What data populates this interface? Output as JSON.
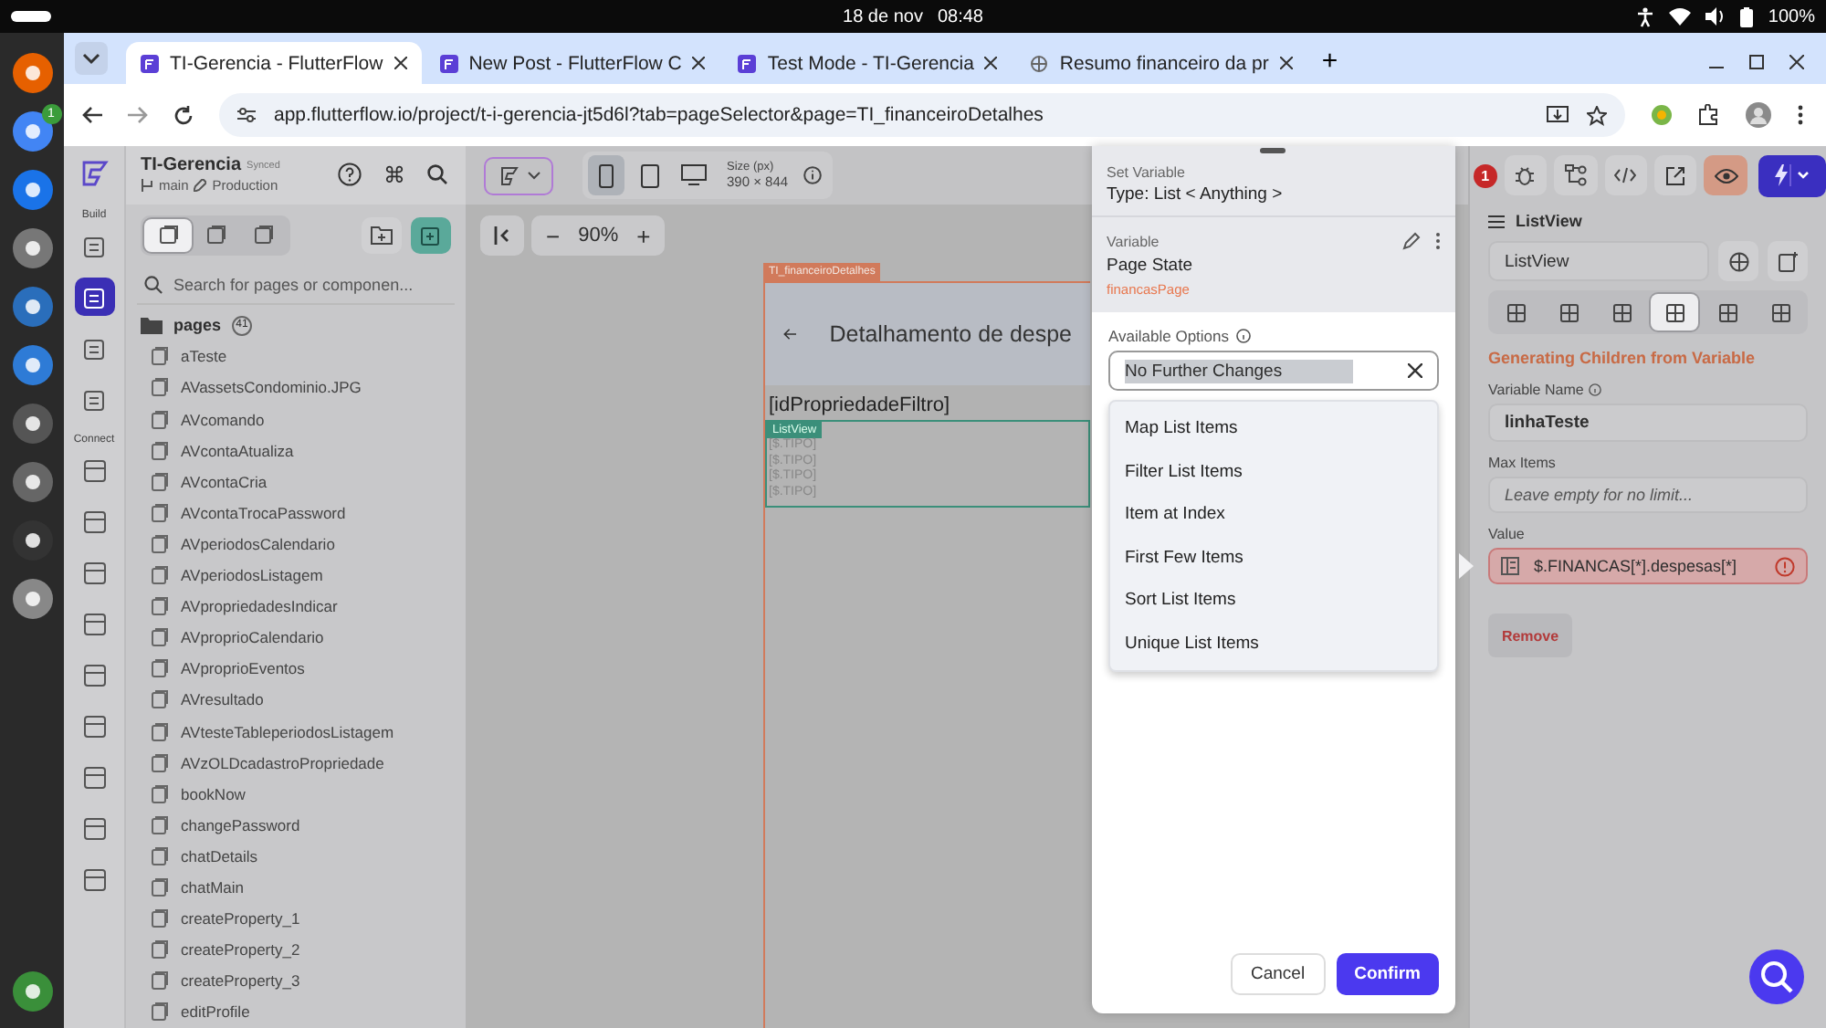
{
  "os_bar": {
    "date": "18 de nov",
    "time": "08:48",
    "battery": "100%"
  },
  "dock": {
    "badge": "1"
  },
  "browser": {
    "tabs": [
      {
        "title": "TI-Gerencia - FlutterFlow",
        "selected": true
      },
      {
        "title": "New Post - FlutterFlow C",
        "selected": false
      },
      {
        "title": "Test Mode - TI-Gerencia",
        "selected": false
      },
      {
        "title": "Resumo financeiro da pr",
        "selected": false
      }
    ],
    "new_tab": "+",
    "url": "app.flutterflow.io/project/t-i-gerencia-jt5d6l?tab=pageSelector&page=TI_financeiroDetalhes"
  },
  "project": {
    "name": "TI-Gerencia",
    "sync": "Synced",
    "branch": "main",
    "env": "Production",
    "shortcut": "⌘"
  },
  "rail": {
    "build_label": "Build",
    "build_items": [
      {
        "selected": false
      },
      {
        "selected": true
      },
      {
        "selected": false
      },
      {
        "selected": false
      }
    ],
    "connect_label": "Connect",
    "connect_items": [
      {
        "selected": false
      },
      {
        "selected": false
      },
      {
        "selected": false
      },
      {
        "selected": false
      },
      {
        "selected": false
      },
      {
        "selected": false
      },
      {
        "selected": false
      },
      {
        "selected": false
      },
      {
        "selected": false
      }
    ]
  },
  "pages_panel": {
    "view_toggles": [
      {
        "selected": true
      },
      {
        "selected": false
      },
      {
        "selected": false
      }
    ],
    "search_placeholder": "Search for pages or componen...",
    "folder": "pages",
    "count": "41",
    "pages": [
      "aTeste",
      "AVassetsCondominio.JPG",
      "AVcomando",
      "AVcontaAtualiza",
      "AVcontaCria",
      "AVcontaTrocaPassword",
      "AVperiodosCalendario",
      "AVperiodosListagem",
      "AVpropriedadesIndicar",
      "AVproprioCalendario",
      "AVproprioEventos",
      "AVresultado",
      "AVtesteTableperiodosListagem",
      "AVzOLDcadastroPropriedade",
      "bookNow",
      "changePassword",
      "chatDetails",
      "chatMain",
      "createProperty_1",
      "createProperty_2",
      "createProperty_3",
      "editProfile"
    ]
  },
  "canvas": {
    "devices": [
      {
        "kind": "phone",
        "selected": true
      },
      {
        "kind": "tablet",
        "selected": false
      },
      {
        "kind": "desktop",
        "selected": false
      }
    ],
    "size_label": "Size (px)",
    "size": "390 × 844",
    "zoom_minus": "−",
    "zoom": "90%",
    "zoom_plus": "+",
    "page_tag": "TI_financeiroDetalhes",
    "page_title": "Detalhamento de despe",
    "filter_text": "[idPropriedadeFiltro]",
    "listview_tag": "ListView",
    "list_rows": [
      "[$.TIPO]",
      "[$.TIPO]",
      "[$.TIPO]",
      "[$.TIPO]"
    ]
  },
  "modal": {
    "title": "Set Variable",
    "type": "Type: List < Anything >",
    "variable_label": "Variable",
    "variable_source": "Page State",
    "variable_name": "financasPage",
    "options_label": "Available Options",
    "selected_option": "No Further Changes",
    "options": [
      "Map List Items",
      "Filter List Items",
      "Item at Index",
      "First Few Items",
      "Sort List Items",
      "Unique List Items"
    ],
    "cancel": "Cancel",
    "confirm": "Confirm"
  },
  "right_panel": {
    "error_count": "1",
    "widget_type": "ListView",
    "widget_name": "ListView",
    "prop_tabs": [
      {
        "selected": false
      },
      {
        "selected": false
      },
      {
        "selected": false
      },
      {
        "selected": true
      },
      {
        "selected": false
      },
      {
        "selected": false
      }
    ],
    "section_title": "Generating Children from Variable",
    "variable_name_label": "Variable Name",
    "variable_name": "linhaTeste",
    "max_items_label": "Max Items",
    "max_items_placeholder": "Leave empty for no limit...",
    "value_label": "Value",
    "value": "$.FINANCAS[*].despesas[*]",
    "remove": "Remove"
  }
}
